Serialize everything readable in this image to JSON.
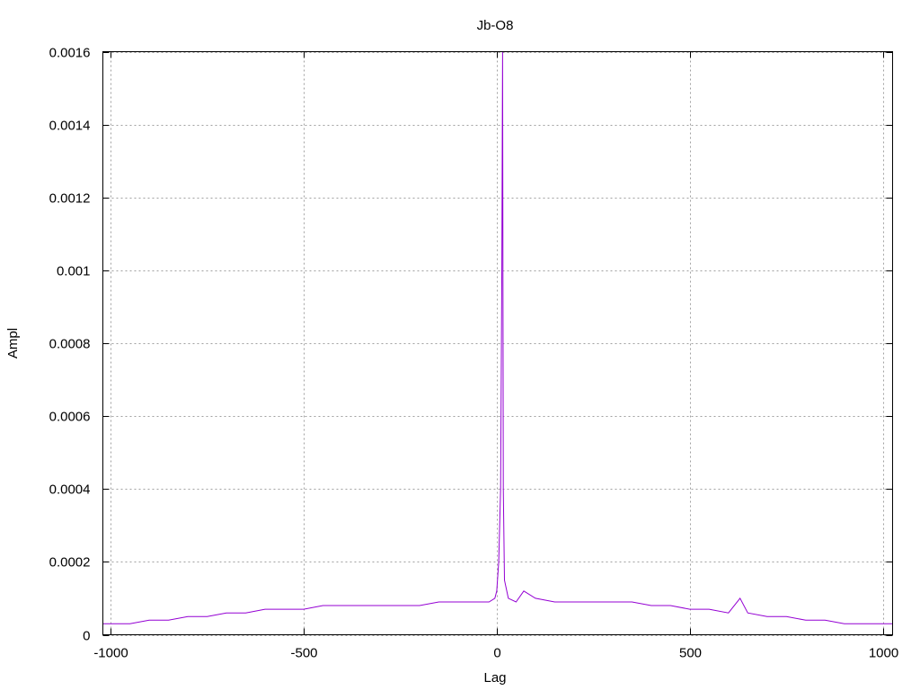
{
  "chart_data": {
    "type": "line",
    "title": "Jb-O8",
    "xlabel": "Lag",
    "ylabel": "Ampl",
    "xlim": [
      -1020,
      1025
    ],
    "ylim": [
      0,
      0.0016
    ],
    "x_ticks": [
      -1000,
      -500,
      0,
      500,
      1000
    ],
    "y_ticks": [
      0,
      0.0002,
      0.0004,
      0.0006,
      0.0008,
      0.001,
      0.0012,
      0.0014,
      0.0016
    ],
    "x_tick_labels": [
      "-1000",
      "-500",
      "0",
      "500",
      "1000"
    ],
    "y_tick_labels": [
      "0",
      "0.0002",
      "0.0004",
      "0.0006",
      "0.0008",
      "0.001",
      "0.0012",
      "0.0014",
      "0.0016"
    ],
    "grid": true,
    "legend": "none",
    "series_color": "#9400d3",
    "series": [
      {
        "x": [
          -1020,
          -1000,
          -950,
          -900,
          -850,
          -800,
          -750,
          -700,
          -650,
          -600,
          -550,
          -500,
          -450,
          -400,
          -350,
          -300,
          -250,
          -200,
          -150,
          -100,
          -50,
          -20,
          -5,
          0,
          5,
          10,
          13,
          15,
          17,
          20,
          30,
          50,
          70,
          100,
          150,
          200,
          250,
          300,
          350,
          400,
          450,
          500,
          550,
          600,
          630,
          650,
          700,
          750,
          800,
          850,
          900,
          950,
          1000,
          1025
        ],
        "values": [
          3e-05,
          3e-05,
          3e-05,
          4e-05,
          4e-05,
          5e-05,
          5e-05,
          6e-05,
          6e-05,
          7e-05,
          7e-05,
          7e-05,
          8e-05,
          8e-05,
          8e-05,
          8e-05,
          8e-05,
          8e-05,
          9e-05,
          9e-05,
          9e-05,
          9e-05,
          0.0001,
          0.00012,
          0.0002,
          0.0004,
          0.00097,
          0.0016,
          0.0004,
          0.00015,
          0.0001,
          9e-05,
          0.00012,
          0.0001,
          9e-05,
          9e-05,
          9e-05,
          9e-05,
          9e-05,
          8e-05,
          8e-05,
          7e-05,
          7e-05,
          6e-05,
          0.0001,
          6e-05,
          5e-05,
          5e-05,
          4e-05,
          4e-05,
          3e-05,
          3e-05,
          3e-05,
          3e-05
        ]
      }
    ]
  }
}
